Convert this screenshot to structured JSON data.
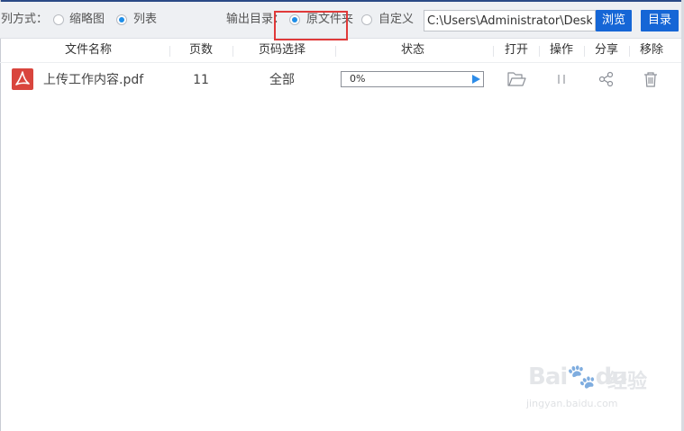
{
  "toolbar": {
    "view_mode_label": "列方式：",
    "view_thumbnail": "缩略图",
    "view_list": "列表",
    "view_selected": "列表",
    "output_dir_label": "输出目录：",
    "output_original": "原文件夹",
    "output_custom": "自定义",
    "output_selected": "原文件夹",
    "path_value": "C:\\Users\\Administrator\\Deskto",
    "browse_label": "浏览",
    "dir_label": "目录",
    "accent_color": "#1566d6",
    "highlight_color": "#e03a3a"
  },
  "table": {
    "headers": {
      "file_name": "文件名称",
      "pages": "页数",
      "page_select": "页码选择",
      "status": "状态",
      "open": "打开",
      "operate": "操作",
      "share": "分享",
      "remove": "移除"
    },
    "rows": [
      {
        "file_icon": "pdf-icon",
        "file_name": "上传工作内容.pdf",
        "pages": "11",
        "page_select": "全部",
        "progress_text": "0%",
        "progress": 0,
        "open_icon": "folder-icon",
        "operate_icon": "pause-icon",
        "share_icon": "share-icon",
        "remove_icon": "trash-icon"
      }
    ]
  },
  "watermark": {
    "brand": "Bai",
    "brand_b": "du",
    "brand_cn": "经验",
    "url": "jingyan.baidu.com"
  }
}
